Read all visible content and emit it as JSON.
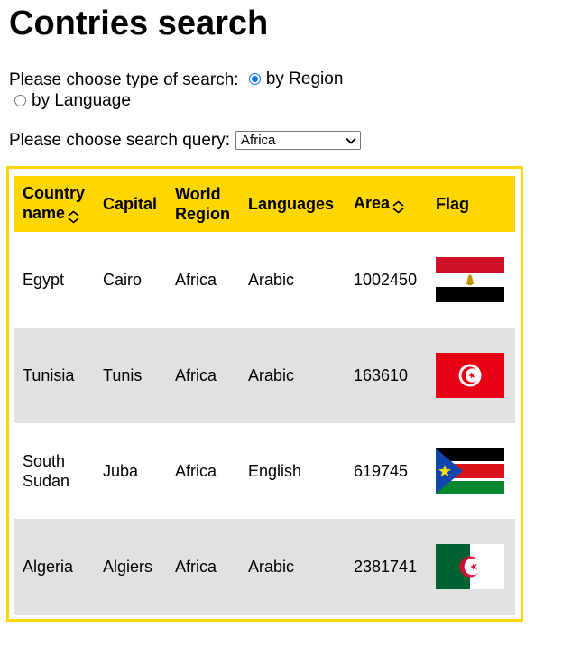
{
  "page": {
    "title": "Contries search"
  },
  "search_type": {
    "label": "Please choose type of search:",
    "options": [
      {
        "label": "by Region",
        "checked": true
      },
      {
        "label": "by Language",
        "checked": false
      }
    ]
  },
  "search_query": {
    "label": "Please choose search query:",
    "selected": "Africa"
  },
  "table": {
    "headers": {
      "country": [
        "Country",
        "name"
      ],
      "capital": "Capital",
      "region": [
        "World",
        "Region"
      ],
      "languages": "Languages",
      "area": "Area",
      "flag": "Flag"
    },
    "rows": [
      {
        "country": "Egypt",
        "capital": "Cairo",
        "region": "Africa",
        "languages": "Arabic",
        "area": "1002450",
        "flag": "flag-egypt-icon"
      },
      {
        "country": "Tunisia",
        "capital": "Tunis",
        "region": "Africa",
        "languages": "Arabic",
        "area": "163610",
        "flag": "flag-tunisia-icon"
      },
      {
        "country_lines": [
          "South",
          "Sudan"
        ],
        "capital": "Juba",
        "region": "Africa",
        "languages": "English",
        "area": "619745",
        "flag": "flag-south-sudan-icon"
      },
      {
        "country": "Algeria",
        "capital": "Algiers",
        "region": "Africa",
        "languages": "Arabic",
        "area": "2381741",
        "flag": "flag-algeria-icon"
      }
    ]
  },
  "colors": {
    "header_bg": "#ffd700",
    "frame_border": "#ffd700",
    "alt_row_bg": "#e3e1df",
    "radio_accent": "#0075ff"
  }
}
